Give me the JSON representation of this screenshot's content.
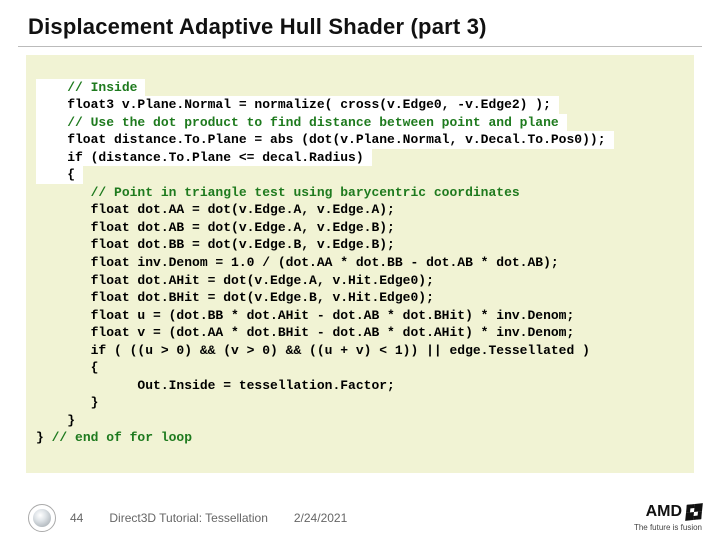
{
  "title": "Displacement Adaptive Hull Shader (part 3)",
  "code": {
    "l1": "    // Inside",
    "l2": "    float3 v.Plane.Normal = normalize( cross(v.Edge0, -v.Edge2) );",
    "l3": "    // Use the dot product to find distance between point and plane",
    "l4": "    float distance.To.Plane = abs (dot(v.Plane.Normal, v.Decal.To.Pos0));",
    "l5": "    if (distance.To.Plane <= decal.Radius)",
    "l6": "    {",
    "l7": "       // Point in triangle test using barycentric coordinates",
    "l8": "       float dot.AA = dot(v.Edge.A, v.Edge.A);",
    "l9": "       float dot.AB = dot(v.Edge.A, v.Edge.B);",
    "l10": "       float dot.BB = dot(v.Edge.B, v.Edge.B);",
    "l11": "       float inv.Denom = 1.0 / (dot.AA * dot.BB - dot.AB * dot.AB);",
    "l12": "       float dot.AHit = dot(v.Edge.A, v.Hit.Edge0);",
    "l13": "       float dot.BHit = dot(v.Edge.B, v.Hit.Edge0);",
    "l14": "       float u = (dot.BB * dot.AHit - dot.AB * dot.BHit) * inv.Denom;",
    "l15": "       float v = (dot.AA * dot.BHit - dot.AB * dot.AHit) * inv.Denom;",
    "l16": "       if ( ((u > 0) && (v > 0) && ((u + v) < 1)) || edge.Tessellated )",
    "l17": "       {",
    "l18": "             Out.Inside = tessellation.Factor;",
    "l19": "       }",
    "l20": "    }",
    "l21a": "}",
    "l21b": " // end of for loop"
  },
  "footer": {
    "slide_number": "44",
    "doc_title": "Direct3D Tutorial: Tessellation",
    "date": "2/24/2021"
  },
  "brand": {
    "name": "AMD",
    "tagline": "The future is fusion"
  }
}
